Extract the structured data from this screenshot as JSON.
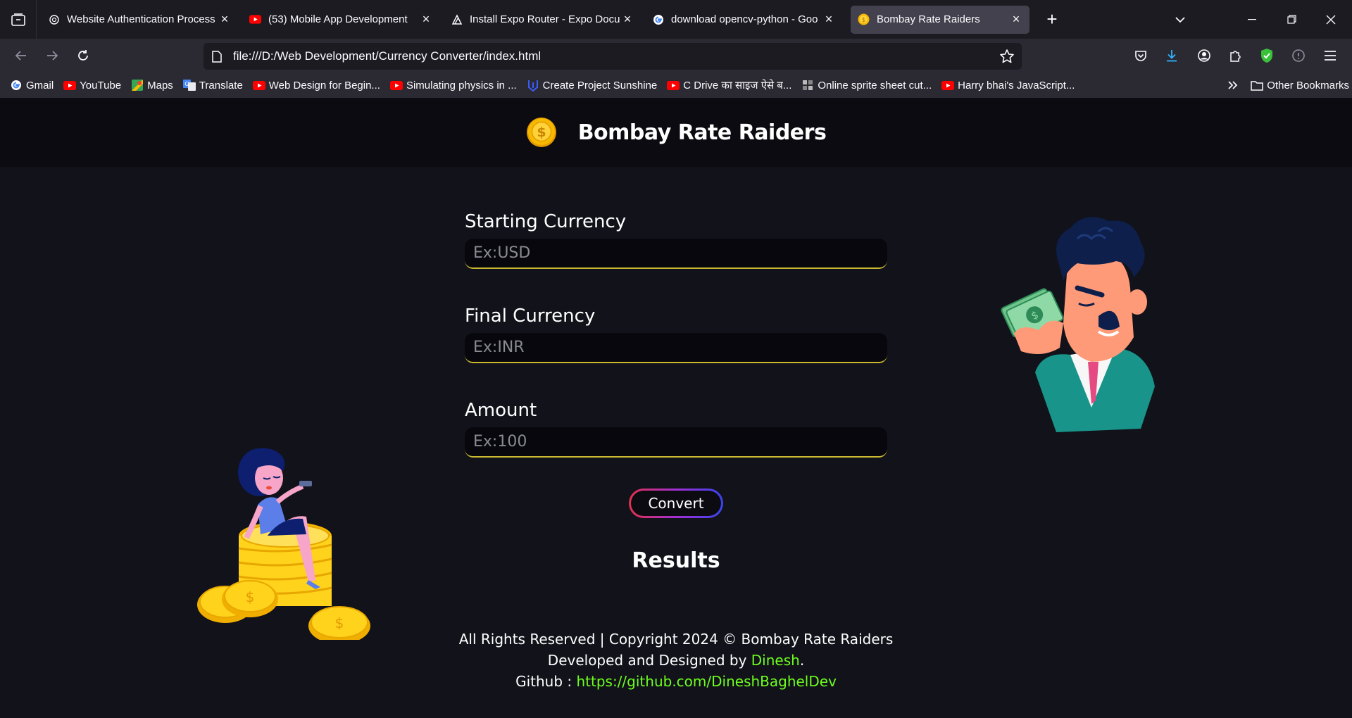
{
  "browser": {
    "tabs": [
      {
        "title": "Website Authentication Process",
        "icon": "openai-icon"
      },
      {
        "title": "(53) Mobile App Development",
        "icon": "youtube-icon"
      },
      {
        "title": "Install Expo Router - Expo Docu",
        "icon": "expo-icon"
      },
      {
        "title": "download opencv-python - Goo",
        "icon": "google-icon"
      },
      {
        "title": "Bombay Rate Raiders",
        "icon": "coin-icon",
        "active": true
      }
    ],
    "url": "file:///D:/Web Development/Currency Converter/index.html",
    "bookmarks": [
      {
        "label": "Gmail",
        "icon": "google-icon"
      },
      {
        "label": "YouTube",
        "icon": "youtube-icon"
      },
      {
        "label": "Maps",
        "icon": "maps-icon"
      },
      {
        "label": "Translate",
        "icon": "translate-icon"
      },
      {
        "label": "Web Design for Begin...",
        "icon": "youtube-icon"
      },
      {
        "label": "Simulating physics in ...",
        "icon": "youtube-icon"
      },
      {
        "label": "Create Project Sunshine",
        "icon": "unity-icon"
      },
      {
        "label": "C Drive का साइज ऐसे ब...",
        "icon": "youtube-icon"
      },
      {
        "label": "Online sprite sheet cut...",
        "icon": "sprite-icon"
      },
      {
        "label": "Harry bhai's JavaScript...",
        "icon": "youtube-icon"
      }
    ],
    "other_bookmarks": "Other Bookmarks"
  },
  "app": {
    "title": "Bombay Rate Raiders",
    "fields": [
      {
        "label": "Starting Currency",
        "placeholder": "Ex:USD"
      },
      {
        "label": "Final Currency",
        "placeholder": "Ex:INR"
      },
      {
        "label": "Amount",
        "placeholder": "Ex:100"
      }
    ],
    "convert_label": "Convert",
    "results_label": "Results",
    "footer": {
      "line1": "All Rights Reserved | Copyright 2024 © Bombay Rate Raiders",
      "line2_prefix": "Developed and Designed by ",
      "author": "Dinesh",
      "line2_suffix": ".",
      "line3_prefix": "Github : ",
      "github_url": "https://github.com/DineshBaghelDev"
    }
  },
  "colors": {
    "accent_gold": "#c9b830",
    "link_green": "#6dff1d",
    "page_bg": "#12121b",
    "header_bg": "#0b0b11"
  }
}
